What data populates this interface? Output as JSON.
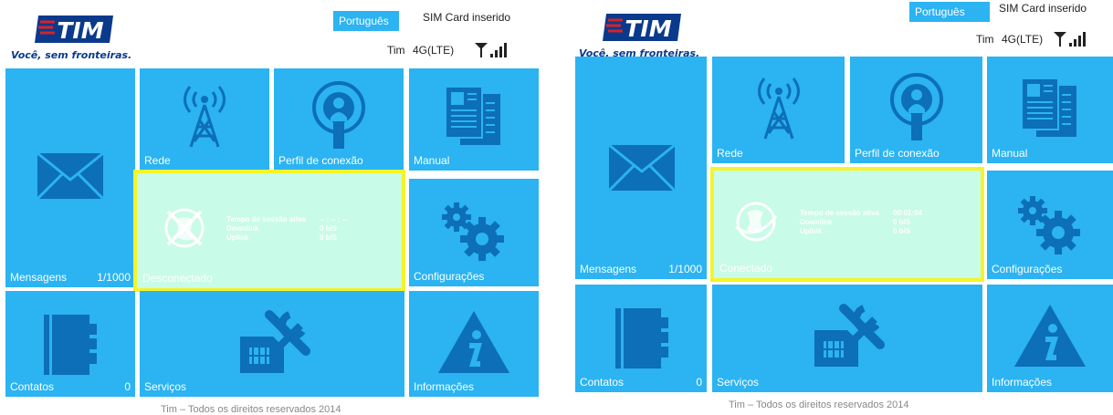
{
  "brand": {
    "logo_text": "TIM",
    "slogan": "Você, sem fronteiras."
  },
  "colors": {
    "tile": "#2bb3f2",
    "icon": "#0c6fb8",
    "status_bg": "#c8fbe8",
    "highlight": "#f4f42a"
  },
  "left": {
    "language_button": "Português",
    "sim_status": "SIM Card inserido",
    "carrier": "Tim",
    "network": "4G(LTE)",
    "tiles": {
      "messages": {
        "label": "Mensagens",
        "count": "1/1000",
        "icon": "envelope-icon"
      },
      "network": {
        "label": "Rede",
        "icon": "antenna-tower-icon"
      },
      "profile": {
        "label": "Perfil de conexão",
        "icon": "connection-profile-icon"
      },
      "manual": {
        "label": "Manual",
        "icon": "documents-icon"
      },
      "settings": {
        "label": "Configurações",
        "icon": "gears-icon"
      },
      "contacts": {
        "label": "Contatos",
        "count": "0",
        "icon": "address-book-icon"
      },
      "services": {
        "label": "Serviços",
        "icon": "sim-tools-icon"
      },
      "info": {
        "label": "Informações",
        "icon": "info-triangle-icon"
      }
    },
    "connection": {
      "state": "Desconectado",
      "session_label": "Tempo de sessão ativa",
      "session_value": "-- : -- : --",
      "downlink_label": "Downlink",
      "downlink_value": "0 b/S",
      "uplink_label": "Uplink",
      "uplink_value": "0 b/S",
      "icon": "disconnected-globe-icon"
    },
    "footer": "Tim – Todos os direitos reservados 2014"
  },
  "right": {
    "language_button": "Português",
    "sim_status": "SIM Card inserido",
    "carrier": "Tim",
    "network": "4G(LTE)",
    "tiles": {
      "messages": {
        "label": "Mensagens",
        "count": "1/1000",
        "icon": "envelope-icon"
      },
      "network": {
        "label": "Rede",
        "icon": "antenna-tower-icon"
      },
      "profile": {
        "label": "Perfil de conexão",
        "icon": "connection-profile-icon"
      },
      "manual": {
        "label": "Manual",
        "icon": "documents-icon"
      },
      "settings": {
        "label": "Configurações",
        "icon": "gears-icon"
      },
      "contacts": {
        "label": "Contatos",
        "count": "0",
        "icon": "address-book-icon"
      },
      "services": {
        "label": "Serviços",
        "icon": "sim-tools-icon"
      },
      "info": {
        "label": "Informações",
        "icon": "info-triangle-icon"
      }
    },
    "connection": {
      "state": "Conectado",
      "session_label": "Tempo de sessão ativa",
      "session_value": "00:01:04",
      "downlink_label": "Downlink",
      "downlink_value": "0 b/S",
      "uplink_label": "Uplink",
      "uplink_value": "0 b/S",
      "icon": "connected-globe-icon"
    },
    "footer": "Tim – Todos os direitos reservados 2014"
  }
}
